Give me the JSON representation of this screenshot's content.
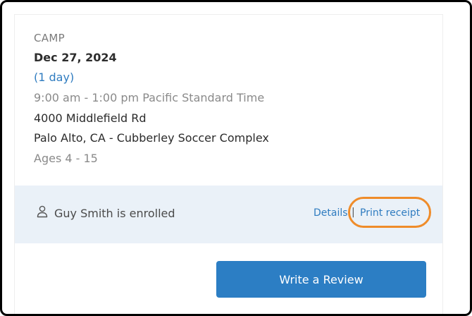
{
  "event": {
    "category": "CAMP",
    "date": "Dec 27, 2024",
    "duration": "(1 day)",
    "time": "9:00 am - 1:00 pm Pacific Standard Time",
    "address": "4000 Middlefield Rd",
    "location": "Palo Alto, CA - Cubberley Soccer Complex",
    "ages": "Ages 4 - 15"
  },
  "enrollment": {
    "icon": "person-icon",
    "status_text": "Guy Smith is enrolled",
    "details_label": "Details",
    "separator": "|",
    "receipt_label": "Print receipt"
  },
  "actions": {
    "review_label": "Write a Review"
  },
  "colors": {
    "link": "#2f7cc0",
    "button": "#2c7ec4",
    "enroll_bar": "#eaf1f8",
    "highlight": "#ef8c2a"
  }
}
